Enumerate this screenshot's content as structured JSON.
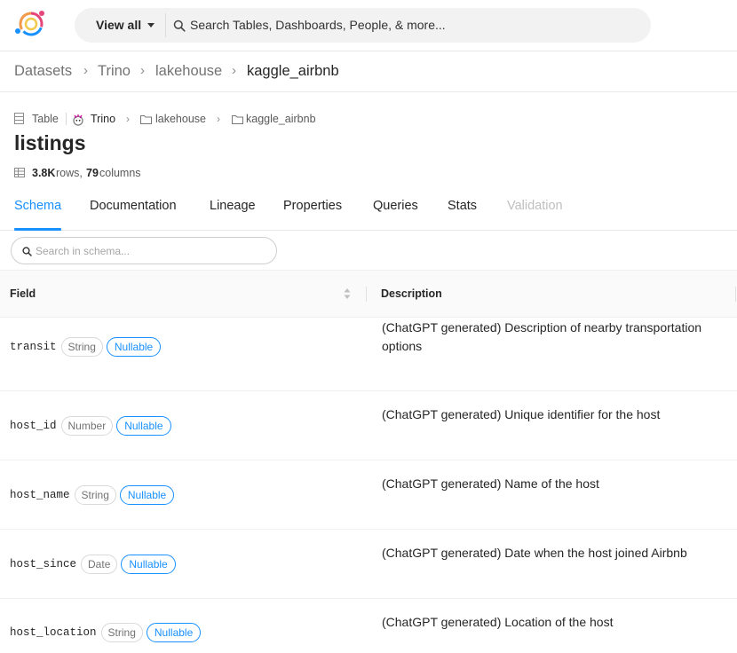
{
  "colors": {
    "accent": "#1890ff",
    "border": "#e8e8e8"
  },
  "topnav": {
    "logo_icon": "datahub-logo",
    "view_all_label": "View all",
    "search_placeholder": "Search Tables, Dashboards, People, & more..."
  },
  "breadcrumb": {
    "items": [
      "Datasets",
      "Trino",
      "lakehouse",
      "kaggle_airbnb"
    ]
  },
  "entity": {
    "type_label": "Table",
    "platform_label": "Trino",
    "path": [
      "lakehouse",
      "kaggle_airbnb"
    ],
    "title": "listings",
    "rows_value": "3.8K",
    "rows_label": "rows,",
    "columns_value": "79",
    "columns_label": "columns"
  },
  "tabs": [
    {
      "label": "Schema",
      "state": "active"
    },
    {
      "label": "Documentation",
      "state": "normal"
    },
    {
      "label": "Lineage",
      "state": "normal"
    },
    {
      "label": "Properties",
      "state": "normal"
    },
    {
      "label": "Queries",
      "state": "normal"
    },
    {
      "label": "Stats",
      "state": "normal"
    },
    {
      "label": "Validation",
      "state": "disabled"
    }
  ],
  "schema": {
    "search_placeholder": "Search in schema...",
    "columns": {
      "field": "Field",
      "description": "Description"
    },
    "rows": [
      {
        "field": "transit",
        "type": "String",
        "nullable": "Nullable",
        "description": "(ChatGPT generated) Description of nearby transportation options"
      },
      {
        "field": "host_id",
        "type": "Number",
        "nullable": "Nullable",
        "description": "(ChatGPT generated) Unique identifier for the host"
      },
      {
        "field": "host_name",
        "type": "String",
        "nullable": "Nullable",
        "description": "(ChatGPT generated) Name of the host"
      },
      {
        "field": "host_since",
        "type": "Date",
        "nullable": "Nullable",
        "description": "(ChatGPT generated) Date when the host joined Airbnb"
      },
      {
        "field": "host_location",
        "type": "String",
        "nullable": "Nullable",
        "description": "(ChatGPT generated) Location of the host"
      }
    ]
  }
}
